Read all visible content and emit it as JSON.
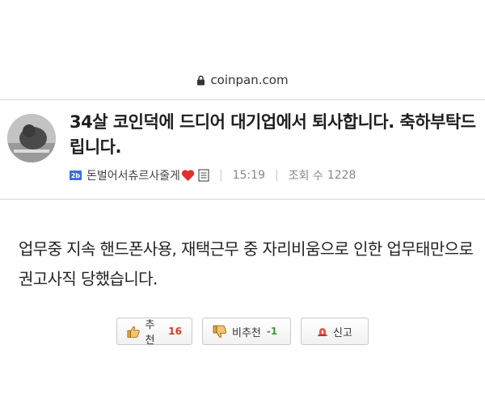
{
  "browser": {
    "url": "coinpan.com"
  },
  "post": {
    "title": "34살 코인덕에 드디어 대기업에서 퇴사합니다. 축하부탁드립니다.",
    "level_badge": "2b",
    "author": "돈벌어서츄르사줄게",
    "time": "15:19",
    "views_label": "조회 수",
    "views": "1228",
    "body": "업무중 지속 핸드폰사용, 재택근무 중 자리비움으로 인한 업무태만으로 권고사직 당했습니다."
  },
  "actions": {
    "recommend_label": "추천",
    "recommend_count": "16",
    "unrecommend_label": "비추천",
    "unrecommend_count": "-1",
    "report_label": "신고"
  },
  "icons": {
    "lock": "lock-icon",
    "heart": "heart-icon",
    "memo": "memo-icon",
    "thumb_up": "thumbs-up-icon",
    "thumb_down": "thumbs-down-icon",
    "report": "siren-icon"
  },
  "colors": {
    "recommend_count": "#d23b2a",
    "unrecommend_count": "#3a9a3a",
    "heart": "#e0302a",
    "level_badge": "#3b6fd8"
  }
}
